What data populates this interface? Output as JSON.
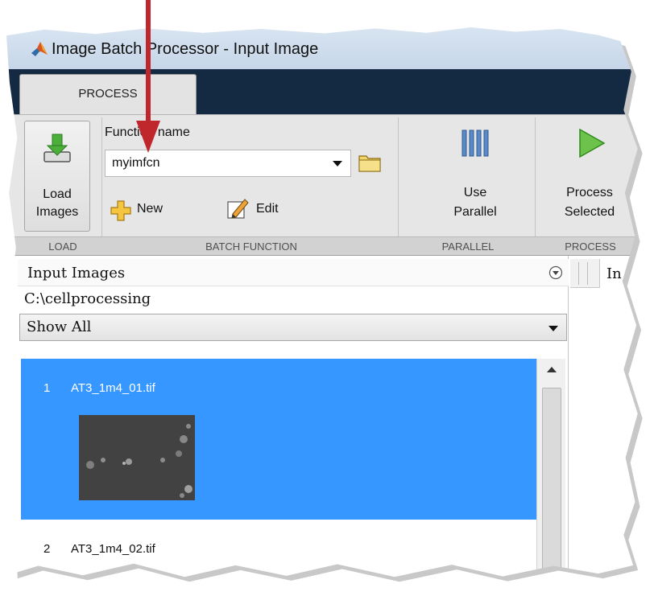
{
  "window": {
    "title": "Image Batch Processor - Input Image"
  },
  "tabs": [
    {
      "label": "PROCESS"
    }
  ],
  "ribbon": {
    "load": {
      "button_label": "Load\nImages",
      "section_label": "LOAD"
    },
    "batch_function": {
      "field_label": "Function name",
      "function_value": "myimfcn",
      "new_label": "New",
      "edit_label": "Edit",
      "section_label": "BATCH FUNCTION"
    },
    "parallel": {
      "button_label": "Use\nParallel",
      "section_label": "PARALLEL"
    },
    "process": {
      "button_label": "Process\nSelected",
      "section_label": "PROCESS"
    }
  },
  "input_panel": {
    "title": "Input Images",
    "folder_path": "C:\\cellprocessing",
    "filter_value": "Show All",
    "items": [
      {
        "index": "1",
        "filename": "AT3_1m4_01.tif",
        "selected": true
      },
      {
        "index": "2",
        "filename": "AT3_1m4_02.tif",
        "selected": false
      }
    ]
  },
  "right_panel": {
    "tab_label": "In"
  },
  "colors": {
    "selection": "#3597ff",
    "title_bar": "#142a43",
    "annotation_arrow": "#c0272d"
  },
  "icons": {
    "app": "matlab-icon",
    "load": "load-images-icon",
    "folder": "folder-icon",
    "new": "plus-icon",
    "edit": "pencil-edit-icon",
    "parallel": "parallel-bars-icon",
    "process": "play-icon",
    "collapse": "collapse-chevron-icon"
  }
}
